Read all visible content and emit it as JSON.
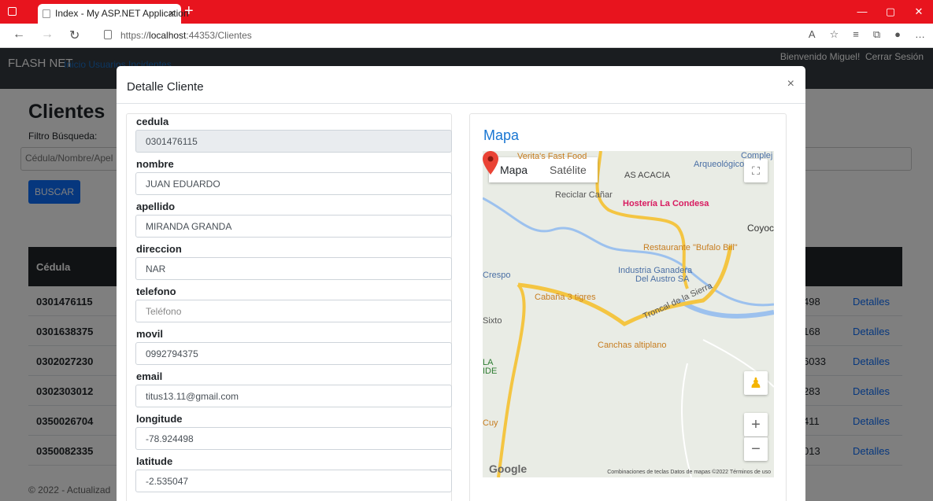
{
  "browser": {
    "tab_title": "Index - My ASP.NET Application",
    "tab_close": "×",
    "new_tab": "+",
    "url_prefix": "https://",
    "url_host": "localhost",
    "url_rest": ":44353/Clientes"
  },
  "navbar": {
    "brand": "FLASH NET",
    "links": "Inicio Usuarios Incidentes",
    "welcome": "Bienvenido Miguel!",
    "logout": "Cerrar Sesión"
  },
  "page": {
    "title": "Clientes",
    "filter_label": "Filtro Búsqueda:",
    "search_placeholder": "Cédula/Nombre/Apel",
    "search_button": "BUSCAR",
    "table_header": "Cédula",
    "rows": [
      {
        "cedula": "0301476115",
        "tel": "498",
        "action": "Detalles"
      },
      {
        "cedula": "0301638375",
        "tel": "168",
        "action": "Detalles"
      },
      {
        "cedula": "0302027230",
        "tel": "6033",
        "action": "Detalles"
      },
      {
        "cedula": "0302303012",
        "tel": "283",
        "action": "Detalles"
      },
      {
        "cedula": "0350026704",
        "tel": "411",
        "action": "Detalles"
      },
      {
        "cedula": "0350082335",
        "tel": "013",
        "action": "Detalles"
      }
    ],
    "footer": "© 2022 - Actualizad"
  },
  "modal": {
    "title": "Detalle Cliente",
    "close": "×",
    "fields": [
      {
        "label": "cedula",
        "value": "0301476115",
        "readonly": true
      },
      {
        "label": "nombre",
        "value": "JUAN EDUARDO"
      },
      {
        "label": "apellido",
        "value": "MIRANDA GRANDA"
      },
      {
        "label": "direccion",
        "value": "NAR"
      },
      {
        "label": "telefono",
        "value": "Teléfono",
        "placeholder": true
      },
      {
        "label": "movil",
        "value": "0992794375"
      },
      {
        "label": "email",
        "value": "titus13.11@gmail.com"
      },
      {
        "label": "longitude",
        "value": "-78.924498"
      },
      {
        "label": "latitude",
        "value": "-2.535047"
      }
    ],
    "map": {
      "title": "Mapa",
      "type_map": "Mapa",
      "type_satellite": "Satélite",
      "labels": {
        "acacia": "AS ACACIA",
        "reciclar": "Reciclar Cañar",
        "hosteria": "Hostería La Condesa",
        "coyoc": "Coyoc",
        "bufalo": "Restaurante \"Bufalo Bill\"",
        "industria1": "Industria Ganadera",
        "industria2": "Del Austro SA",
        "crespo": "Crespo",
        "cabana": "Cabaña 3 tigres",
        "sixto": "Sixto",
        "canchas": "Canchas altiplano",
        "troncal": "Troncal de la Sierra",
        "arqueologico": "Arqueológico",
        "complej": "Complej",
        "verita": "Verita's Fast Food",
        "cuy": "Cuy",
        "la": "LA",
        "ide": "IDE"
      },
      "zoom_in": "+",
      "zoom_out": "−",
      "google": "Google",
      "footer": "Combinaciones de teclas   Datos de mapas ©2022   Términos de uso"
    }
  }
}
